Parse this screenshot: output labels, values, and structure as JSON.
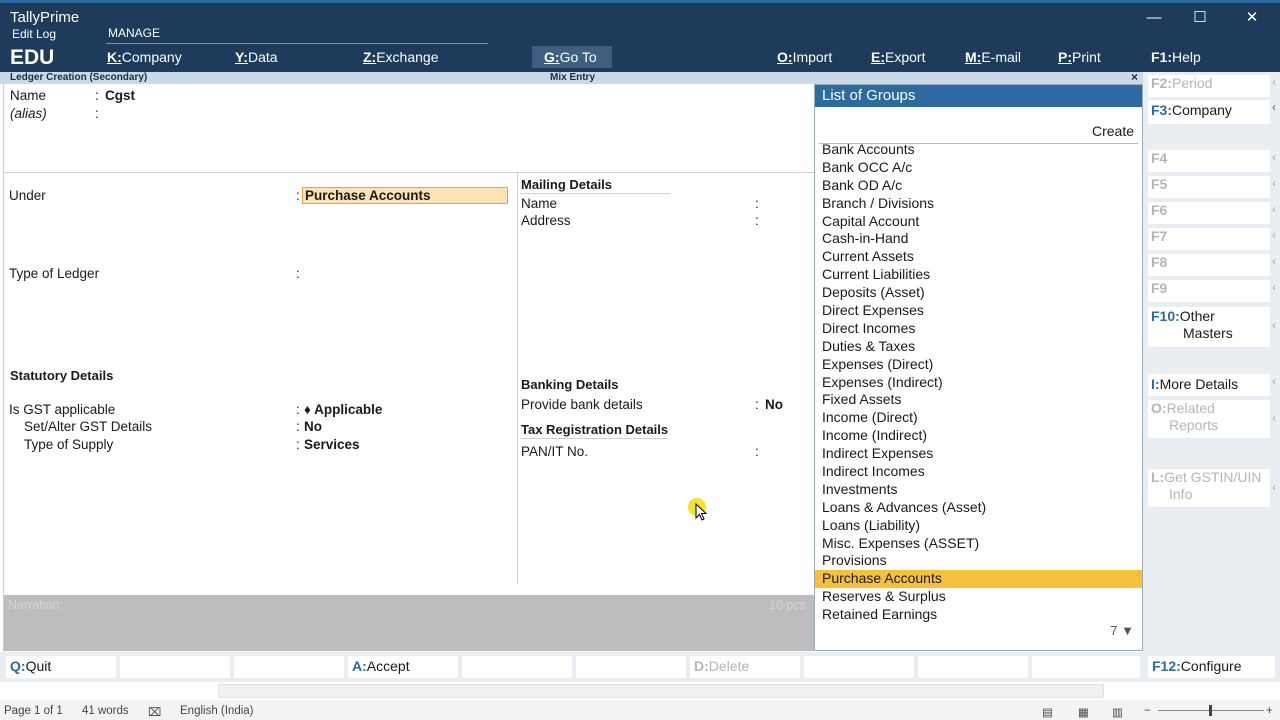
{
  "app": {
    "name": "TallyPrime",
    "sub": "Edit Log",
    "edition": "EDU",
    "mode": "MANAGE"
  },
  "topmenu": [
    {
      "key": "K:",
      "label": "Company"
    },
    {
      "key": "Y:",
      "label": "Data"
    },
    {
      "key": "Z:",
      "label": "Exchange"
    },
    {
      "key": "G:",
      "label": "Go To"
    },
    {
      "key": "O:",
      "label": "Import"
    },
    {
      "key": "E:",
      "label": "Export"
    },
    {
      "key": "M:",
      "label": "E-mail"
    },
    {
      "key": "P:",
      "label": "Print"
    },
    {
      "key": "F1:",
      "label": "Help"
    }
  ],
  "screen": {
    "title": "Ledger Creation (Secondary)",
    "mode": "Mix Entry",
    "close": "×"
  },
  "form": {
    "name_label": "Name",
    "name_value": "Cgst",
    "alias_label": "(alias)",
    "under_label": "Under",
    "under_value": "Purchase Accounts",
    "type_label": "Type of Ledger",
    "statutory_heading": "Statutory Details",
    "gst_label": "Is GST applicable",
    "gst_value": "♦ Applicable",
    "setalter_label": "Set/Alter GST Details",
    "setalter_value": "No",
    "supply_label": "Type of Supply",
    "supply_value": "Services",
    "mailing_heading": "Mailing Details",
    "mail_name_label": "Name",
    "mail_address_label": "Address",
    "banking_heading": "Banking Details",
    "bank_label": "Provide bank details",
    "bank_value": "No",
    "tax_heading": "Tax Registration Details",
    "pan_label": "PAN/IT No.",
    "colon": ":"
  },
  "narration": {
    "label": "Narration:",
    "count": "10 pcs"
  },
  "groups": {
    "title": "List of Groups",
    "create": "Create",
    "more": "7 ▼",
    "items": [
      "Bank Accounts",
      "Bank OCC A/c",
      "Bank OD A/c",
      "Branch / Divisions",
      "Capital Account",
      "Cash-in-Hand",
      "Current Assets",
      "Current Liabilities",
      "Deposits (Asset)",
      "Direct Expenses",
      "Direct Incomes",
      "Duties & Taxes",
      "Expenses (Direct)",
      "Expenses (Indirect)",
      "Fixed Assets",
      "Income (Direct)",
      "Income (Indirect)",
      "Indirect Expenses",
      "Indirect Incomes",
      "Investments",
      "Loans & Advances (Asset)",
      "Loans (Liability)",
      "Misc. Expenses (ASSET)",
      "Provisions",
      "Purchase Accounts",
      "Reserves & Surplus",
      "Retained Earnings"
    ],
    "selected": "Purchase Accounts"
  },
  "rightpanel": {
    "f2": {
      "k": "F2:",
      "l": "Period"
    },
    "f3": {
      "k": "F3:",
      "l": "Company"
    },
    "f4": {
      "k": "F4",
      "l": ""
    },
    "f5": {
      "k": "F5",
      "l": ""
    },
    "f6": {
      "k": "F6",
      "l": ""
    },
    "f7": {
      "k": "F7",
      "l": ""
    },
    "f8": {
      "k": "F8",
      "l": ""
    },
    "f9": {
      "k": "F9",
      "l": ""
    },
    "f10": {
      "k": "F10:",
      "l": "Other",
      "l2": "Masters"
    },
    "i": {
      "k": "I:",
      "l": "More Details"
    },
    "o": {
      "k": "O:",
      "l": "Related",
      "l2": "Reports"
    },
    "l": {
      "k": "L:",
      "l": "Get GSTIN/UIN",
      "l2": "Info"
    },
    "f12": {
      "k": "F12:",
      "l": "Configure"
    }
  },
  "bottom": {
    "quit": {
      "k": "Q:",
      "l": "Quit"
    },
    "accept": {
      "k": "A:",
      "l": "Accept"
    },
    "delete": {
      "k": "D:",
      "l": "Delete"
    }
  },
  "status": {
    "page": "Page 1 of 1",
    "words": "41 words",
    "lang": "English (India)"
  }
}
